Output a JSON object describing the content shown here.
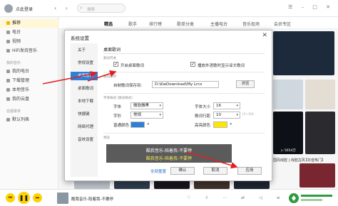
{
  "app": {
    "username": "点此登录",
    "search_placeholder": "搜索",
    "nav_arrows": "‹ › ↻",
    "window_controls": "☰ – □ ✕"
  },
  "sidebar": {
    "items": [
      {
        "label": "推荐",
        "active": true
      },
      {
        "label": "电台"
      },
      {
        "label": "视频"
      },
      {
        "label": "HiFi发烧音乐"
      }
    ],
    "section_mine": "我的音乐",
    "mine_items": [
      {
        "label": "我的电台"
      },
      {
        "label": "下载管理"
      },
      {
        "label": "本地音乐"
      },
      {
        "label": "我的云盘"
      }
    ],
    "section_created": "自建歌单",
    "created_items": [
      {
        "label": "默认列表"
      }
    ]
  },
  "tabs": [
    {
      "label": "精选",
      "active": true
    },
    {
      "label": "歌手"
    },
    {
      "label": "排行榜"
    },
    {
      "label": "歌单分类"
    },
    {
      "label": "主播电台"
    },
    {
      "label": "音乐现场"
    },
    {
      "label": "会员专区"
    }
  ],
  "content": {
    "captions": [
      "国风戏腔 | 戏腔古风",
      "【抖音热门】"
    ],
    "play_count": "▷ 5654万"
  },
  "player": {
    "now_playing": "酷我音乐-陪着我-不要停",
    "icon_row": "♡ ⇩ ⋯ ⇄ ◁ ≡",
    "colors": {
      "accent": "#ffd200"
    }
  },
  "dialog": {
    "title": "系统设置",
    "close": "✕",
    "nav": [
      {
        "label": "关于"
      },
      {
        "label": "常规设置"
      },
      {
        "label": "桌面歌词",
        "active": true
      },
      {
        "label": "桌面歌词"
      },
      {
        "label": "本地下载"
      },
      {
        "label": "快捷键"
      },
      {
        "label": "网络代理"
      },
      {
        "label": "音效设置"
      }
    ],
    "section_title": "桌面歌词",
    "group_options": "歌词开关",
    "checkbox_enable": {
      "label": "开启桌面歌词",
      "checked": true
    },
    "checkbox_playback": {
      "label": "播放外语歌时显示译文歌词",
      "checked": true
    },
    "group_save": "歌词保存",
    "save_path_label": "自制歌词保存到:",
    "save_path_value": "D:\\KwDownload\\My Lrcx",
    "browse_button": "浏览",
    "group_style": "字体样式 (歌词样式)",
    "font_label": "字体",
    "font_value": "微软雅黑",
    "font_size_label": "字体大小",
    "font_size_value": "16",
    "style_label": "字形",
    "style_value": "常规",
    "line_spacing_label": "歌词行距",
    "line_spacing_value": "10",
    "line_spacing_hint": "(1~10)",
    "normal_color_label": "普通颜色",
    "highlight_color_label": "高亮颜色",
    "colors": {
      "normal": "#2e7fd6",
      "highlight": "#ffe600"
    },
    "preview_group": "预览",
    "preview_line1": "酷我音乐-陪着我-不要停",
    "preview_line2": "酷我音乐-陪着我-不要停",
    "reset_link": "全部重置",
    "ok_button": "确认",
    "cancel_button": "取消",
    "apply_button": "应用"
  }
}
